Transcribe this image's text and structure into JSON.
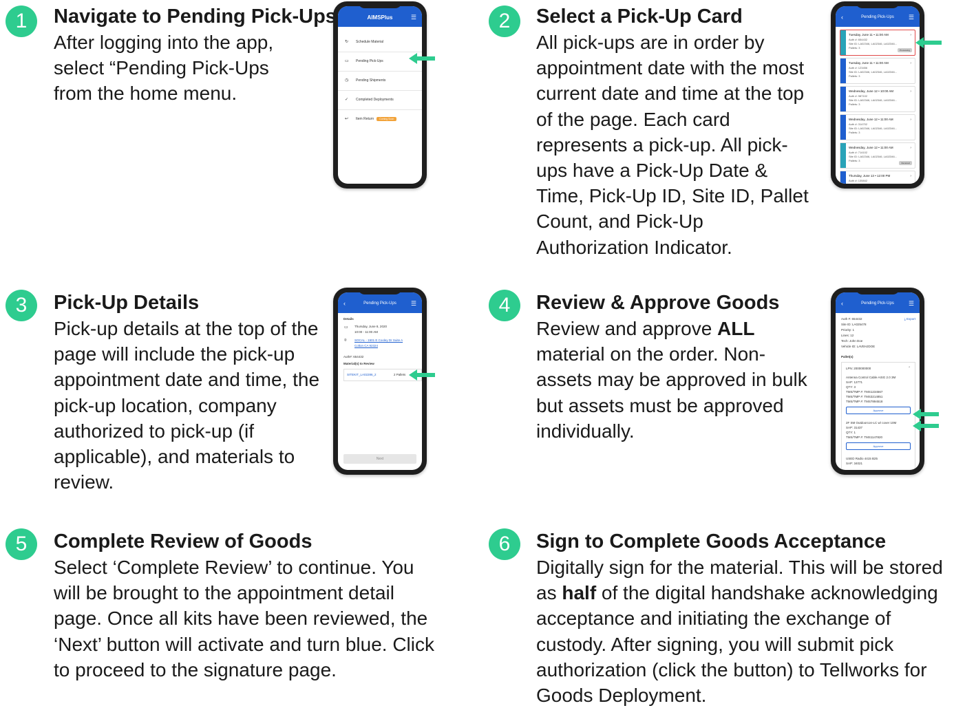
{
  "accent_color": "#2ecc8f",
  "app_color": "#1f5fcf",
  "steps": [
    {
      "num": "1",
      "title": "Navigate to Pending Pick-Ups",
      "body": "After logging into the app, select “Pending Pick-Ups from the home menu."
    },
    {
      "num": "2",
      "title": "Select a Pick-Up Card",
      "body": "All pick-ups are in order by appointment date with the most current date and time at the top of the page. Each card represents a pick-up. All pick-ups have a Pick-Up Date & Time, Pick-Up ID, Site ID, Pallet Count, and Pick-Up Authorization Indicator."
    },
    {
      "num": "3",
      "title": "Pick-Up Details",
      "body": "Pick-up details at the top of the page will include the pick-up appointment date and time, the pick-up location, company authorized to pick-up (if applicable), and materials to review."
    },
    {
      "num": "4",
      "title": "Review & Approve Goods",
      "body_pre": "Review and approve ",
      "body_bold": "ALL",
      "body_post": " material on the order. Non-assets may be approved in bulk but assets must be approved individually."
    },
    {
      "num": "5",
      "title": "Complete Review of Goods",
      "body": "Select ‘Complete Review’ to continue. You will be brought to the appointment detail page. Once all kits have been reviewed, the ‘Next’ button will activate and turn blue. Click to proceed to the signature page."
    },
    {
      "num": "6",
      "title": "Sign to Complete Goods Acceptance",
      "body_pre": "Digitally sign for the material. This will be stored as ",
      "body_bold": "half",
      "body_post": " of the digital handshake acknowledging acceptance and initiating the exchange of custody. After signing, you will submit pick authorization (click the button) to Tellworks for Goods Deployment."
    }
  ],
  "phone1": {
    "logo": "AIMSPlus",
    "menu": [
      "Schedule Material",
      "Pending Pick-Ups",
      "Pending Shipments",
      "Completed Deployments",
      "Item Return"
    ],
    "tag": "Coming Soon"
  },
  "phone2": {
    "title": "Pending Pick-Ups",
    "cards": [
      {
        "date": "Tuesday, June 11 • 11:00 AM",
        "auth": "Auth #: 654432",
        "site": "Site ID: LA02346, LA02346, LA02346...",
        "pallets": "Pallets: 3",
        "pill": "Processing"
      },
      {
        "date": "Tuesday, June 11 • 11:00 AM",
        "auth": "Auth #: 123456",
        "site": "Site ID: LA02346, LA02346, LA02346...",
        "pallets": "Pallets: 3",
        "pill": ""
      },
      {
        "date": "Wednesday, June 12 • 10:00 AM",
        "auth": "Auth #: 987102",
        "site": "Site ID: LA02346, LA02346, LA02346...",
        "pallets": "Pallets: 3",
        "pill": ""
      },
      {
        "date": "Wednesday, June 12 • 11:00 AM",
        "auth": "Auth #: 314702",
        "site": "Site ID: LA02346, LA02346, LA02346...",
        "pallets": "Pallets: 3",
        "pill": ""
      },
      {
        "date": "Wednesday, June 12 • 11:00 AM",
        "auth": "Auth #: 714102",
        "site": "Site ID: LA02346, LA02346, LA02346...",
        "pallets": "Pallets: 3",
        "pill": "Received"
      },
      {
        "date": "Thursday, June 13 • 12:00 PM",
        "auth": "Auth #: 135842",
        "site": "",
        "pallets": "",
        "pill": ""
      }
    ]
  },
  "phone3": {
    "title": "Pending Pick-Ups",
    "details_label": "Details",
    "date": "Thursday, June 8, 2020",
    "time": "10:00 - 11:00 AM",
    "addr1": "SOCAL - 1501 E Cooley Dr Suite A",
    "addr2": "Colton CA 92324",
    "auth": "Auth#: 654432",
    "materials_label": "Material(s) to Review",
    "kit": "SITEKIT_LA02286_2",
    "pallets": "2 Pallets",
    "next": "Next"
  },
  "phone4": {
    "title": "Pending Pick-Ups",
    "export": "Export",
    "info": [
      "Auth #: 654432",
      "Site ID: LA025478",
      "Priority: 1",
      "Lines: 12",
      "Tech: John Doe",
      "Vehicle ID: LAVEHJDOE"
    ],
    "pallets_label": "Pallet(s)",
    "lpn": "LPN: 2000000000",
    "item1": [
      "Antenna Control Cable AISG 2.0 3M",
      "SAP: 12771",
      "QTY: 3",
      "TMS/TMP #: TMS1234567",
      "TMS/TMP #: TMS3214851",
      "TMS/TMP #: TMS7894518"
    ],
    "item2": [
      "2F SM Outdoorcon-LC w/ cover 10M",
      "SAP: 31437",
      "QTY: 1",
      "TMS/TMP #: TMS1147820"
    ],
    "item3": [
      "USED Radio 4415 B25",
      "SAP: 34021"
    ],
    "approve": "Approve"
  }
}
